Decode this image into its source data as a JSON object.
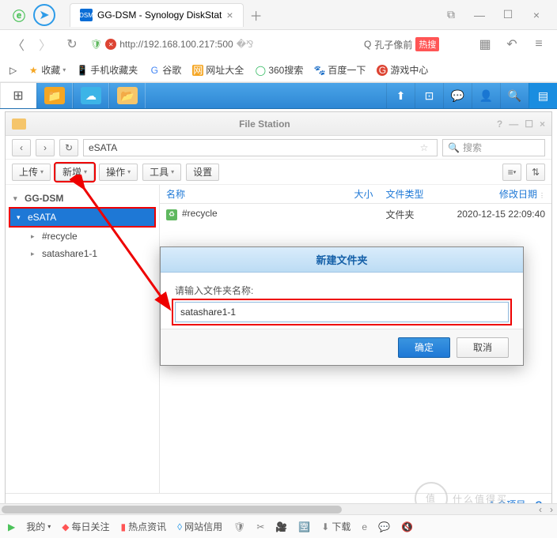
{
  "browser": {
    "tab_title": "GG-DSM - Synology DiskStat",
    "url": "http://192.168.100.217:500",
    "search_placeholder": "孔子像前",
    "hot_label": "热搜"
  },
  "bookmarks": {
    "fav": "收藏",
    "mobile": "手机收藏夹",
    "google": "谷歌",
    "netall": "网址大全",
    "sou360": "360搜索",
    "baidu": "百度一下",
    "game": "游戏中心"
  },
  "filestation": {
    "title": "File Station",
    "path": "eSATA",
    "search_placeholder": "搜索",
    "toolbar": {
      "upload": "上传",
      "new": "新增",
      "action": "操作",
      "tool": "工具",
      "settings": "设置"
    },
    "tree": {
      "root": "GG-DSM",
      "selected": "eSATA",
      "children": [
        "#recycle",
        "satashare1-1"
      ]
    },
    "columns": {
      "name": "名称",
      "size": "大小",
      "type": "文件类型",
      "date": "修改日期"
    },
    "rows": [
      {
        "name": "#recycle",
        "type": "文件夹",
        "date": "2020-12-15 22:09:40"
      }
    ],
    "status": {
      "count": "1 个项目"
    }
  },
  "dialog": {
    "title": "新建文件夹",
    "label": "请输入文件夹名称:",
    "value": "satashare1-1",
    "ok": "确定",
    "cancel": "取消"
  },
  "bottombar": {
    "mine": "我的",
    "daily": "每日关注",
    "hotnews": "热点资讯",
    "credit": "网站信用",
    "download": "下载"
  },
  "watermark": "什么值得买"
}
